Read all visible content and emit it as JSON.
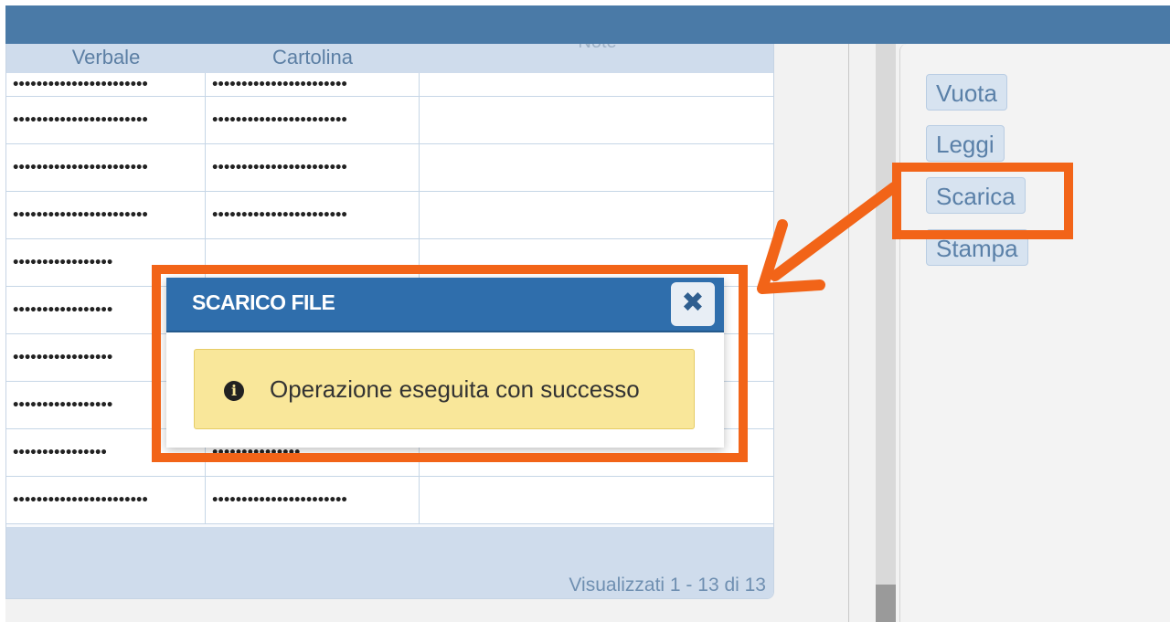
{
  "grid": {
    "columns": [
      "Verbale",
      "Cartolina",
      "Note"
    ],
    "rows": [
      [
        "•••••••••••••••••••••••",
        "•••••••••••••••••••••••",
        ""
      ],
      [
        "•••••••••••••••••••••••",
        "•••••••••••••••••••••••",
        ""
      ],
      [
        "•••••••••••••••••••••••",
        "•••••••••••••••••••••••",
        ""
      ],
      [
        "•••••••••••••••••••••••",
        "•••••••••••••••••••••••",
        ""
      ],
      [
        "•••••••••••••••••",
        "",
        ""
      ],
      [
        "•••••••••••••••••",
        "",
        ""
      ],
      [
        "•••••••••••••••••",
        "",
        ""
      ],
      [
        "•••••••••••••••••",
        "",
        ""
      ],
      [
        "••••••••••••••••",
        "•••••••••••••••",
        ""
      ],
      [
        "•••••••••••••••••••••••",
        "•••••••••••••••••••••••",
        ""
      ]
    ],
    "pager_text": "Visualizzati 1 - 13 di 13"
  },
  "actions": {
    "vuota": "Vuota",
    "leggi": "Leggi",
    "scarica": "Scarica",
    "stampa": "Stampa"
  },
  "dialog": {
    "title": "SCARICO FILE",
    "close_symbol": "✖",
    "info_symbol": "i",
    "message": "Operazione eseguita con successo"
  },
  "colors": {
    "highlight": "#f26418",
    "header_blue": "#2f6eac",
    "message_bg": "#f9e79a"
  }
}
